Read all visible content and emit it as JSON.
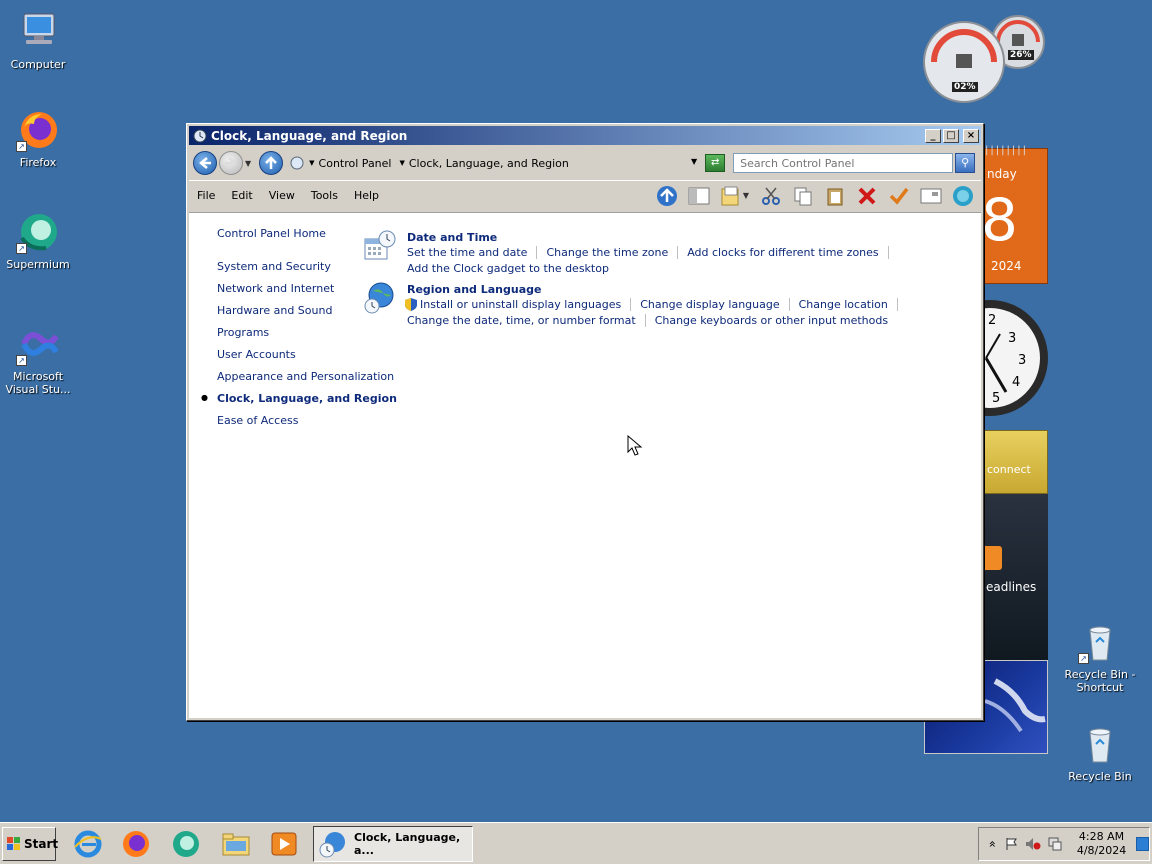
{
  "desktop": {
    "icons_left": [
      {
        "label": "Computer",
        "icon": "computer-icon"
      },
      {
        "label": "Firefox",
        "icon": "firefox-icon"
      },
      {
        "label": "Supermium",
        "icon": "supermium-icon"
      },
      {
        "label": "Microsoft Visual Stu...",
        "icon": "visual-studio-icon"
      }
    ],
    "icons_right": [
      {
        "label": "Recycle Bin - Shortcut",
        "icon": "recycle-bin-icon"
      },
      {
        "label": "Recycle Bin",
        "icon": "recycle-bin-icon"
      }
    ],
    "background_color": "#3a6ea5"
  },
  "gadgets": {
    "cpu_meter": {
      "cpu": "02%",
      "memory": "26%"
    },
    "calendar": {
      "day_fragment": "nday",
      "date_fragment": "8",
      "year": "2024"
    },
    "feed_fragment": "eadlines",
    "connect_fragment": "connect"
  },
  "window": {
    "title": "Clock, Language, and Region",
    "controls": {
      "minimize": "_",
      "maximize": "□",
      "close": "×"
    },
    "address": {
      "breadcrumbs": [
        "Control Panel",
        "Clock, Language, and Region"
      ]
    },
    "search": {
      "placeholder": "Search Control Panel"
    },
    "menu": [
      "File",
      "Edit",
      "View",
      "Tools",
      "Help"
    ],
    "leftnav": {
      "home": "Control Panel Home",
      "items": [
        "System and Security",
        "Network and Internet",
        "Hardware and Sound",
        "Programs",
        "User Accounts",
        "Appearance and Personalization",
        "Clock, Language, and Region",
        "Ease of Access"
      ],
      "current_index": 6
    },
    "sections": [
      {
        "title": "Date and Time",
        "icon": "date-time-icon",
        "rows": [
          [
            "Set the time and date",
            "Change the time zone",
            "Add clocks for different time zones"
          ],
          [
            "Add the Clock gadget to the desktop"
          ]
        ]
      },
      {
        "title": "Region and Language",
        "icon": "globe-icon",
        "rows": [
          [
            "Install or uninstall display languages",
            "Change display language",
            "Change location"
          ],
          [
            "Change the date, time, or number format",
            "Change keyboards or other input methods"
          ]
        ]
      }
    ]
  },
  "taskbar": {
    "start_label": "Start",
    "active_task": "Clock, Language, a...",
    "clock_time": "4:28 AM",
    "clock_date": "4/8/2024",
    "tray_expand": "»"
  }
}
